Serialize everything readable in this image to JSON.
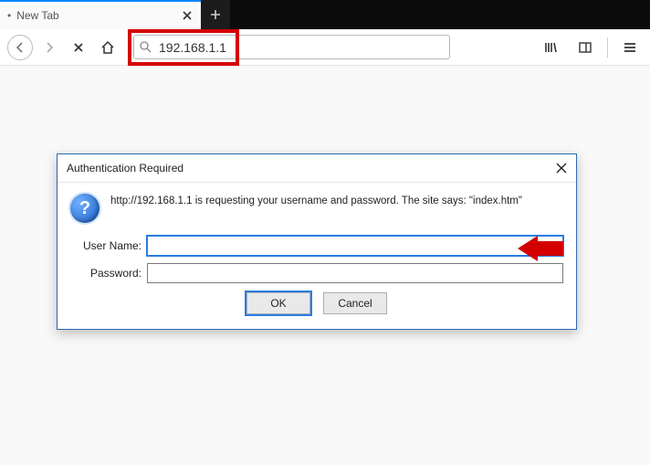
{
  "tab": {
    "title": "New Tab"
  },
  "urlbar": {
    "value": "192.168.1.1"
  },
  "dialog": {
    "title": "Authentication Required",
    "message": "http://192.168.1.1 is requesting your username and password. The site says: \"index.htm\"",
    "username_label": "User Name:",
    "password_label": "Password:",
    "username_value": "",
    "password_value": "",
    "ok_label": "OK",
    "cancel_label": "Cancel"
  }
}
